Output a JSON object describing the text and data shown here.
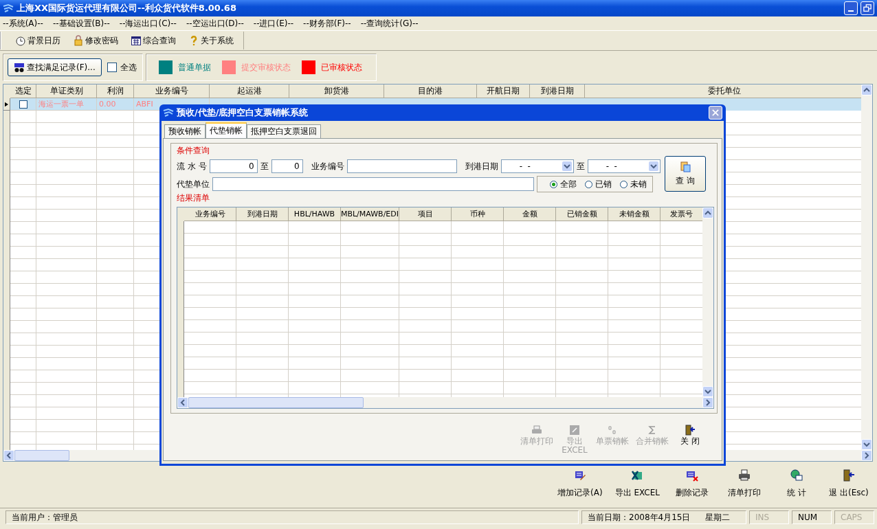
{
  "window": {
    "title": "上海XX国际货运代理有限公司--利众货代软件8.00.68"
  },
  "menu": [
    "--系统(A)--",
    "--基础设置(B)--",
    "--海运出口(C)--",
    "--空运出口(D)--",
    "--进口(E)--",
    "--财务部(F)--",
    "--查询统计(G)--"
  ],
  "toolbar": [
    "背景日历",
    "修改密码",
    "综合查询",
    "关于系统"
  ],
  "filter": {
    "find_button": "查找满足记录(F)...",
    "select_all": {
      "label": "全选",
      "checked": false
    }
  },
  "legend": [
    {
      "label": "普通单据",
      "color": "#008080"
    },
    {
      "label": "提交审核状态",
      "color": "#ff8080"
    },
    {
      "label": "已审核状态",
      "color": "#ff0000"
    }
  ],
  "table": {
    "columns": [
      "选定",
      "单证类别",
      "利润",
      "业务编号",
      "起运港",
      "卸货港",
      "目的港",
      "开航日期",
      "到港日期",
      "委托单位"
    ],
    "rows": [
      {
        "selected": true,
        "checked": false,
        "color": "#ff8080",
        "cells": [
          "",
          "海运一票一单",
          "0.00",
          "ABFI"
        ]
      }
    ]
  },
  "dialog": {
    "title": "预收/代垫/底押空白支票销帐系统",
    "tabs": [
      {
        "label": "预收销帐",
        "selected": false
      },
      {
        "label": "代垫销帐",
        "selected": true
      },
      {
        "label": "抵押空白支票退回",
        "selected": false
      }
    ],
    "query_group": "条件查询",
    "serial_label": "流 水 号",
    "serial_from": "0",
    "to_label": "至",
    "serial_to": "0",
    "business_no_label": "业务编号",
    "arrival_label": "到港日期",
    "arrival_from": "-  -",
    "arrival_to_label": "至",
    "arrival_to": "-  -",
    "payer_label": "代垫单位",
    "radios": [
      {
        "label": "全部",
        "selected": true
      },
      {
        "label": "已销",
        "selected": false
      },
      {
        "label": "未销",
        "selected": false
      }
    ],
    "query_button": "查 询",
    "result_group": "结果清单",
    "columns": [
      "业务编号",
      "到港日期",
      "HBL/HAWB",
      "MBL/MAWB/EDI",
      "项目",
      "币种",
      "金额",
      "已销金额",
      "未销金额",
      "发票号"
    ],
    "buttons": [
      {
        "label": "清单打印",
        "disabled": true
      },
      {
        "label": "导出\nEXCEL",
        "disabled": true
      },
      {
        "label": "单票销帐",
        "disabled": true
      },
      {
        "label": "合并销帐",
        "disabled": true
      },
      {
        "label": "关 闭",
        "disabled": false
      }
    ]
  },
  "actions": [
    "增加记录(A)",
    "导出 EXCEL",
    "删除记录",
    "清单打印",
    "统 计",
    "退 出(Esc)"
  ],
  "status_bar": {
    "user": "当前用户：管理员",
    "date": "当前日期：2008年4月15日",
    "weekday": "星期二",
    "indicators": [
      {
        "label": "INS",
        "on": false
      },
      {
        "label": "NUM",
        "on": true
      },
      {
        "label": "CAPS",
        "on": false
      }
    ]
  }
}
